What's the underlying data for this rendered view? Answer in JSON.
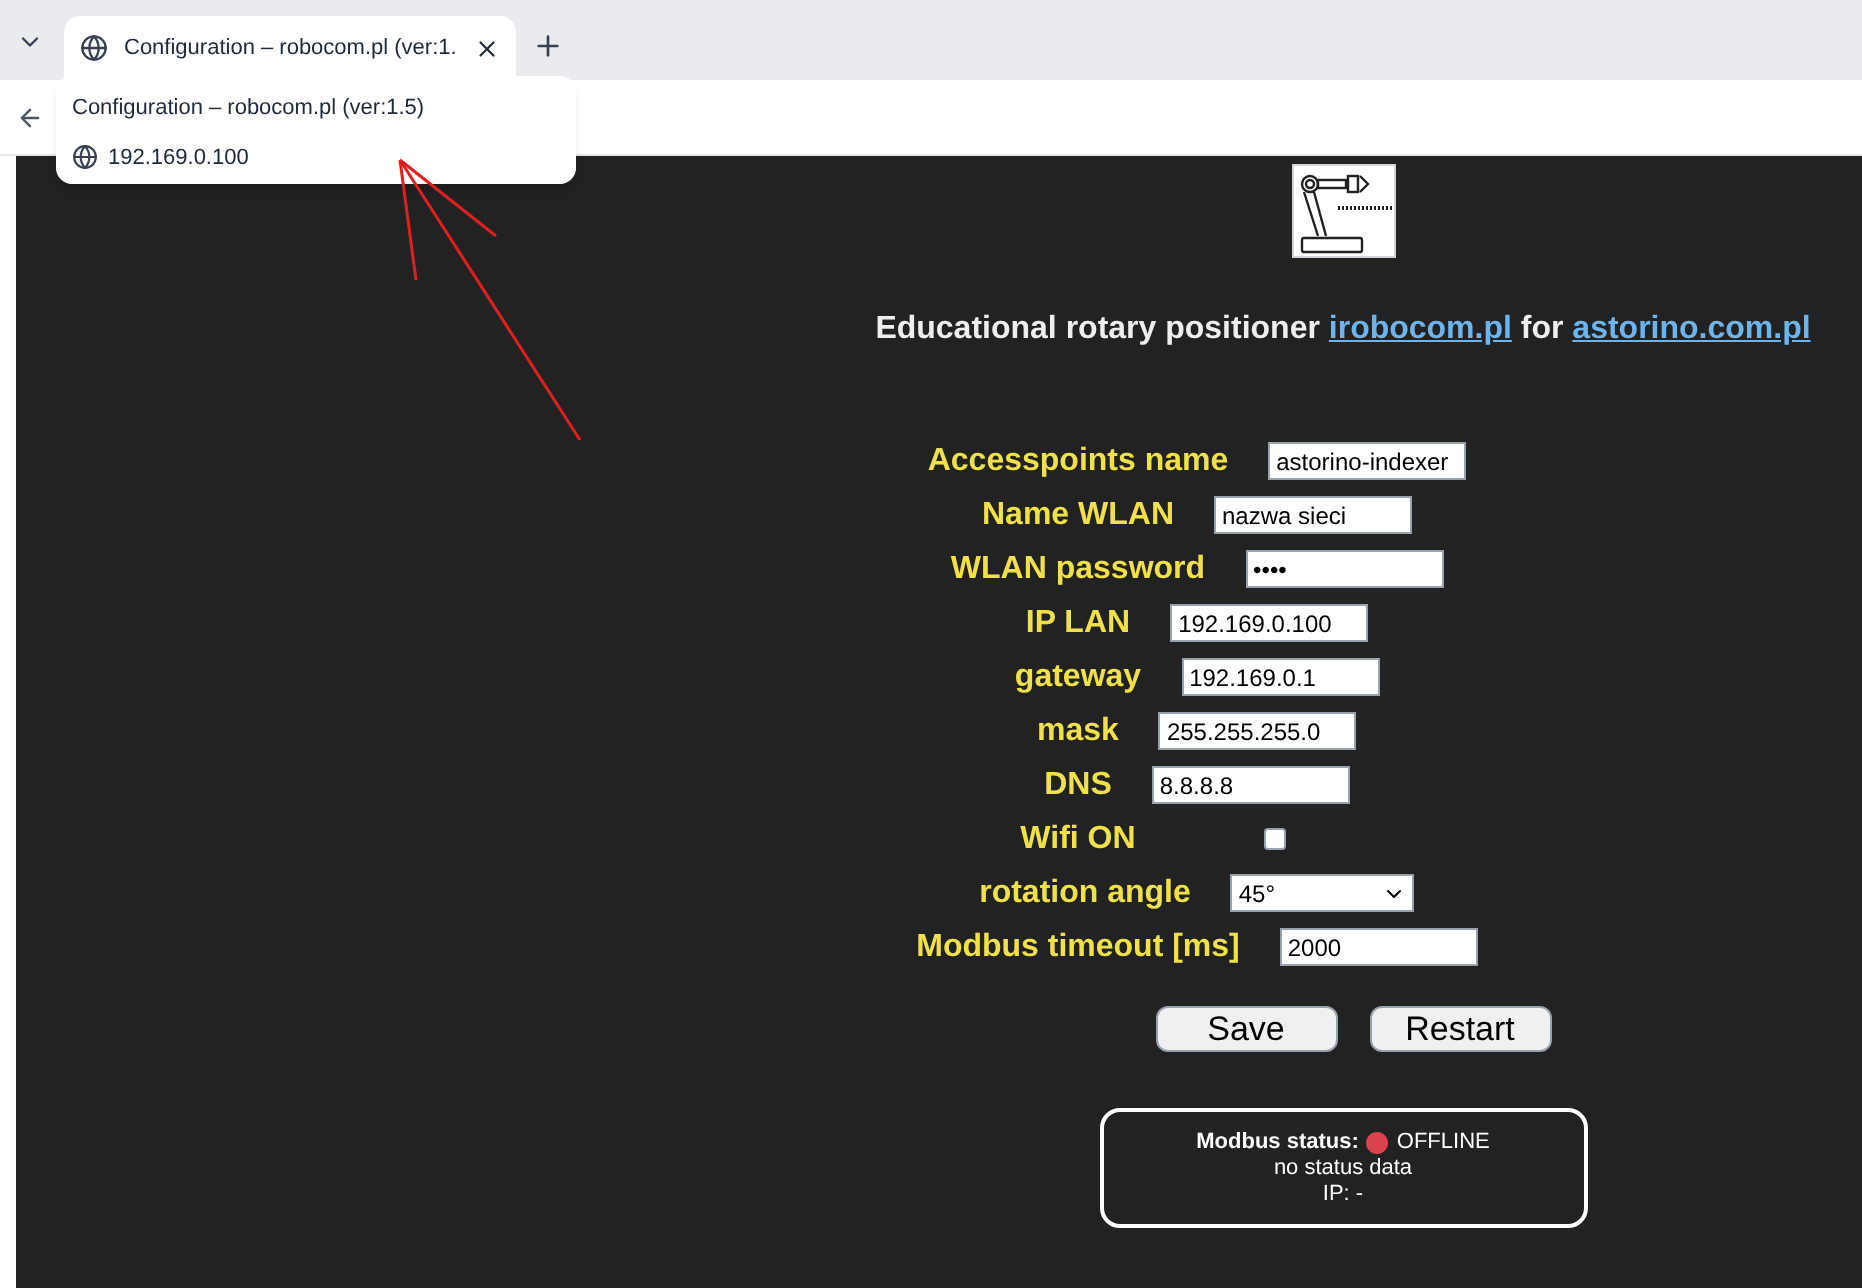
{
  "browser": {
    "tab": {
      "title": "Configuration – robocom.pl (ver:1.",
      "selected": true
    },
    "tooltip": {
      "title": "Configuration – robocom.pl (ver:1.5)",
      "url": "192.169.0.100"
    }
  },
  "page": {
    "heading": {
      "prefix": "Educational rotary positioner",
      "link_1": "irobocom.pl",
      "middle": "for",
      "link_2": "astorino.com.pl"
    },
    "fields": [
      {
        "kind": "text",
        "label": "Accesspoints name",
        "value": "astorino-indexer"
      },
      {
        "kind": "text",
        "label": "Name WLAN",
        "value": "nazwa sieci"
      },
      {
        "kind": "password",
        "label": "WLAN password",
        "value": "••••"
      },
      {
        "kind": "text",
        "label": "IP LAN",
        "value": "192.169.0.100"
      },
      {
        "kind": "text",
        "label": "gateway",
        "value": "192.169.0.1"
      },
      {
        "kind": "text",
        "label": "mask",
        "value": "255.255.255.0"
      },
      {
        "kind": "text",
        "label": "DNS",
        "value": "8.8.8.8"
      },
      {
        "kind": "checkbox",
        "label": "Wifi ON",
        "checked": false
      },
      {
        "kind": "select",
        "label": "rotation angle",
        "value": "45°"
      },
      {
        "kind": "text",
        "label": "Modbus timeout [ms]",
        "value": "2000"
      }
    ],
    "buttons": [
      "Save",
      "Restart"
    ],
    "status": {
      "label": "Modbus status:",
      "color": "#d9434d",
      "state": "OFFLINE",
      "detail": "no status data",
      "ip": "IP: -"
    }
  }
}
